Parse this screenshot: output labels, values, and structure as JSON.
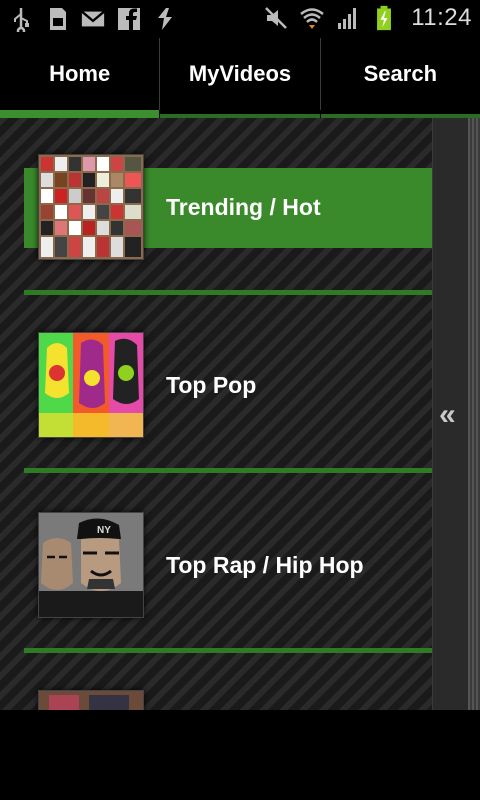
{
  "status_bar": {
    "icons_left": [
      "usb-icon",
      "sd-card-icon",
      "gmail-icon",
      "facebook-icon",
      "sync-icon"
    ],
    "icons_right": [
      "mute-icon",
      "wifi-icon",
      "signal-icon",
      "battery-charging-icon"
    ],
    "time": "11:24"
  },
  "tabs": [
    {
      "label": "Home",
      "active": true
    },
    {
      "label": "MyVideos",
      "active": false
    },
    {
      "label": "Search",
      "active": false
    }
  ],
  "categories": [
    {
      "label": "Trending / Hot",
      "active": true,
      "thumb_icon": "trending-collage-thumbnail"
    },
    {
      "label": "Top Pop",
      "active": false,
      "thumb_icon": "pop-art-thumbnail"
    },
    {
      "label": "Top Rap / Hip Hop",
      "active": false,
      "thumb_icon": "hip-hop-thumbnail"
    }
  ],
  "sidebar": {
    "toggle_glyph": "«"
  },
  "colors": {
    "accent": "#3a8a2c",
    "divider": "#2f7a25"
  }
}
